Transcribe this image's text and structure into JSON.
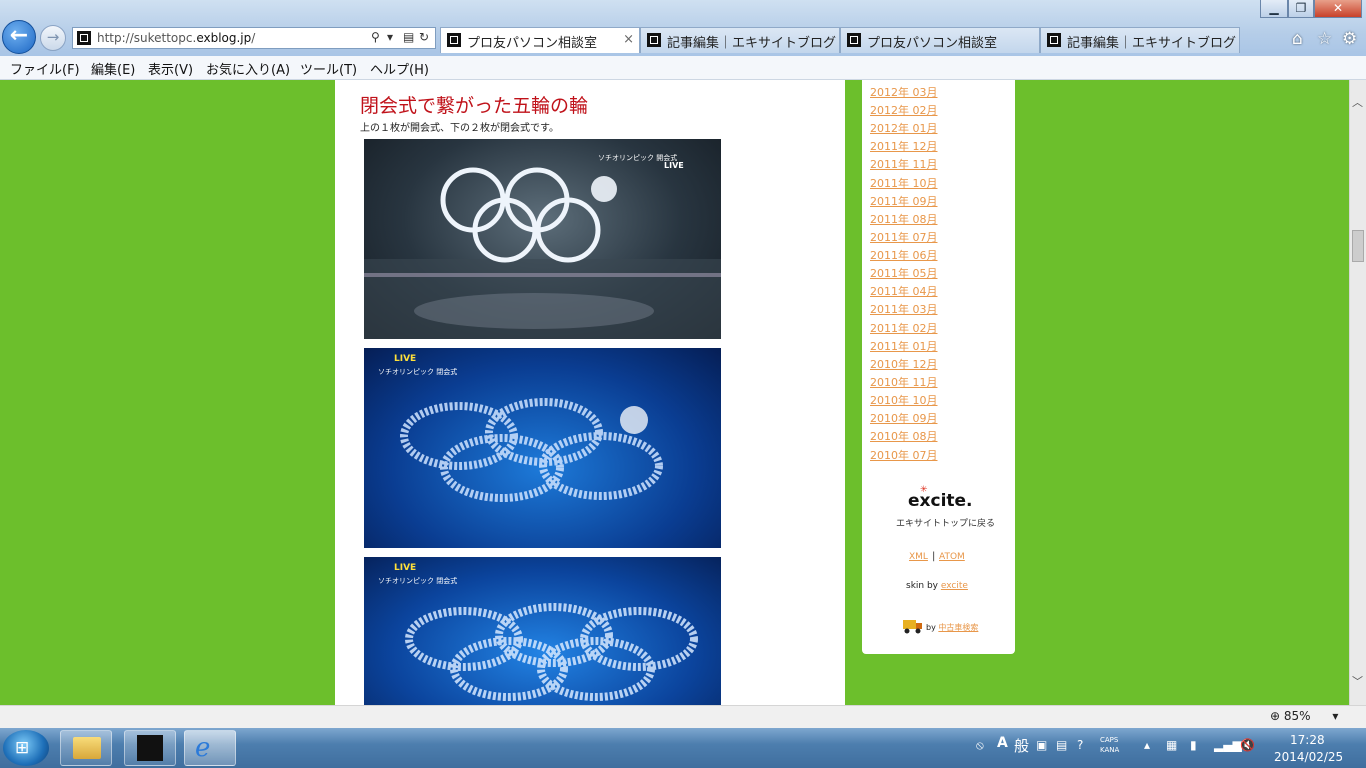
{
  "browser": {
    "url": "http://sukettopc.exblog.jp/",
    "url_prefix": "http://sukettopc.",
    "url_domain": "exblog.jp",
    "url_suffix": "/",
    "tabs": [
      {
        "label": "プロ友パソコン相談室",
        "active": true
      },
      {
        "label": "記事編集｜エキサイトブログ",
        "active": false
      },
      {
        "label": "プロ友パソコン相談室",
        "active": false
      },
      {
        "label": "記事編集｜エキサイトブログ",
        "active": false
      }
    ],
    "tab_close": "×",
    "menu": [
      "ファイル(F)",
      "編集(E)",
      "表示(V)",
      "お気に入り(A)",
      "ツール(T)",
      "ヘルプ(H)"
    ],
    "zoom": "85%"
  },
  "post": {
    "title": "閉会式で繋がった五輪の輪",
    "caption": "上の１枚が開会式、下の２枚が閉会式です。",
    "photo1_overlay": "ソチオリンピック 開会式",
    "photo1_live": "LIVE",
    "photo2_live": "LIVE",
    "photo2_overlay": "ソチオリンピック 閉会式",
    "photo3_live": "LIVE",
    "photo3_overlay": "ソチオリンピック 閉会式"
  },
  "sidebar": {
    "archives": [
      "2012年 03月",
      "2012年 02月",
      "2012年 01月",
      "2011年 12月",
      "2011年 11月",
      "2011年 10月",
      "2011年 09月",
      "2011年 08月",
      "2011年 07月",
      "2011年 06月",
      "2011年 05月",
      "2011年 04月",
      "2011年 03月",
      "2011年 02月",
      "2011年 01月",
      "2010年 12月",
      "2010年 11月",
      "2010年 10月",
      "2010年 09月",
      "2010年 08月",
      "2010年 07月"
    ],
    "excite_logo": "excite.",
    "excite_back": "エキサイトトップに戻る",
    "xml": "XML",
    "separator": "|",
    "atom": "ATOM",
    "skin_by": "skin by ",
    "skin_link": "excite",
    "ad_by": "by ",
    "ad_link": "中古車検索"
  },
  "taskbar": {
    "ime_mode": "A",
    "ime_kanji": "般",
    "caps": "CAPS",
    "kana": "KANA",
    "time": "17:28",
    "date": "2014/02/25"
  }
}
